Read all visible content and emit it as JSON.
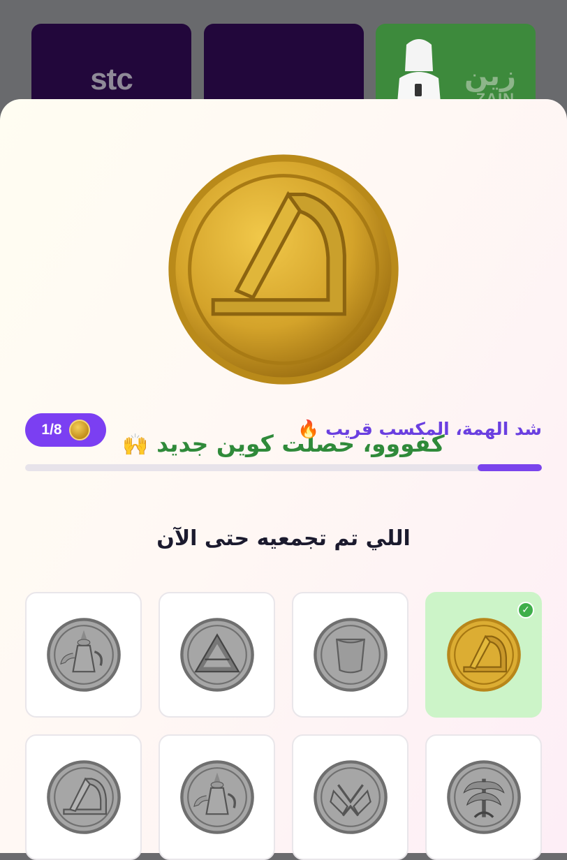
{
  "brands": {
    "stc": "stc",
    "zain_ar": "زين",
    "zain_en": "ZAIN"
  },
  "reward": {
    "headline": "كفووو، حصلت كوين جديد",
    "headline_emoji": "🙌"
  },
  "progress": {
    "motivation": "شد الهمة، المكسب قريب",
    "motivation_emoji": "🔥",
    "count_label": "1/8",
    "collected": 1,
    "total": 8,
    "fill_fraction": 0.125,
    "accent": "#7b3ff2"
  },
  "collection": {
    "title": "اللي تم تجمعيه حتى الآن",
    "coins": [
      {
        "icon": "gold-arc-coin-icon",
        "collected": true
      },
      {
        "icon": "silver-cup-coin-icon",
        "collected": false
      },
      {
        "icon": "silver-pyramid-coin-icon",
        "collected": false
      },
      {
        "icon": "silver-dallah-coin-icon",
        "collected": false
      },
      {
        "icon": "silver-palm-coin-icon",
        "collected": false
      },
      {
        "icon": "silver-hands-coin-icon",
        "collected": false
      },
      {
        "icon": "silver-dallah-coin-icon",
        "collected": false
      },
      {
        "icon": "silver-arc-coin-icon",
        "collected": false
      }
    ]
  }
}
